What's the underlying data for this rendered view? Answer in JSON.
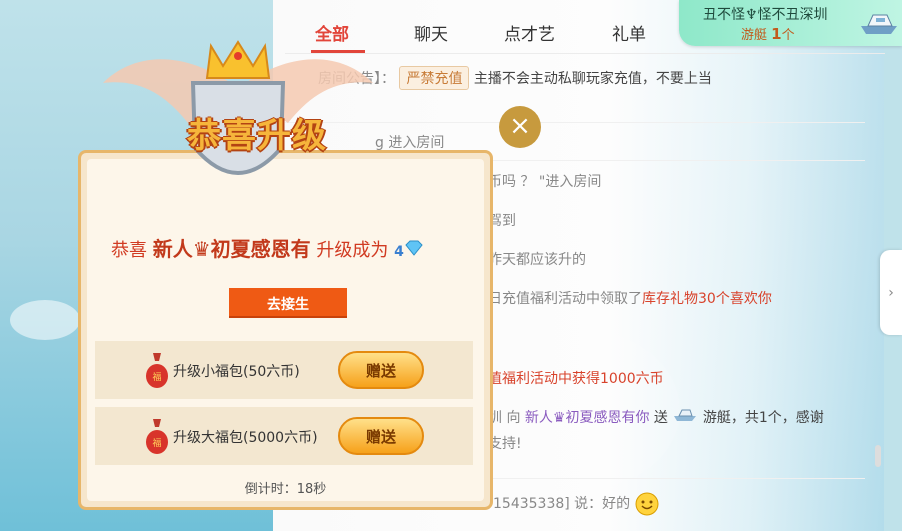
{
  "tabs": [
    "全部",
    "聊天",
    "点才艺",
    "礼单"
  ],
  "notice": {
    "line1": "丑不怪♆怪不丑深圳",
    "gift_name": "游艇",
    "count": "1",
    "unit": "个"
  },
  "chat": {
    "announcement_prefix": "房间公告】：",
    "announcement_tag": "严禁充值",
    "announcement_text": "主播不会主动私聊玩家充值，不要上当",
    "m1": "g 进入房间",
    "m2": "币吗 ？ \"进入房间",
    "m3": "驾到",
    "m4": "昨天都应该升的",
    "m5_prefix": "日充值福利活动中领取了",
    "m5_red": "库存礼物30个喜欢你",
    "m6": "值福利活动中获得1000六币",
    "m7_prefix": "圳 向 ",
    "m7_user": "新人♛初夏感恩有你",
    "m7_mid": " 送 ",
    "m7_suffix": " 游艇，共1个，感谢",
    "m7_line2": "支持!",
    "m8": "15435338] 说：好的"
  },
  "dialog": {
    "banner": "恭喜升级",
    "congrats_prefix": "恭喜 ",
    "username": "新人♛初夏感恩有",
    "congrats_suffix": " 升级成为",
    "level": "4",
    "cta": "去接生",
    "gift1_label": "升级小福包(50六币)",
    "gift2_label": "升级大福包(5000六币)",
    "gift_button": "赠送",
    "countdown": "倒计时：18秒"
  },
  "close_symbol": "×",
  "side_handle_symbol": "›",
  "colors": {
    "accent_red": "#e2453a",
    "cta_orange": "#ef5a14",
    "dialog_border": "#e7b66a",
    "notice_green": "#8ee8c9"
  }
}
